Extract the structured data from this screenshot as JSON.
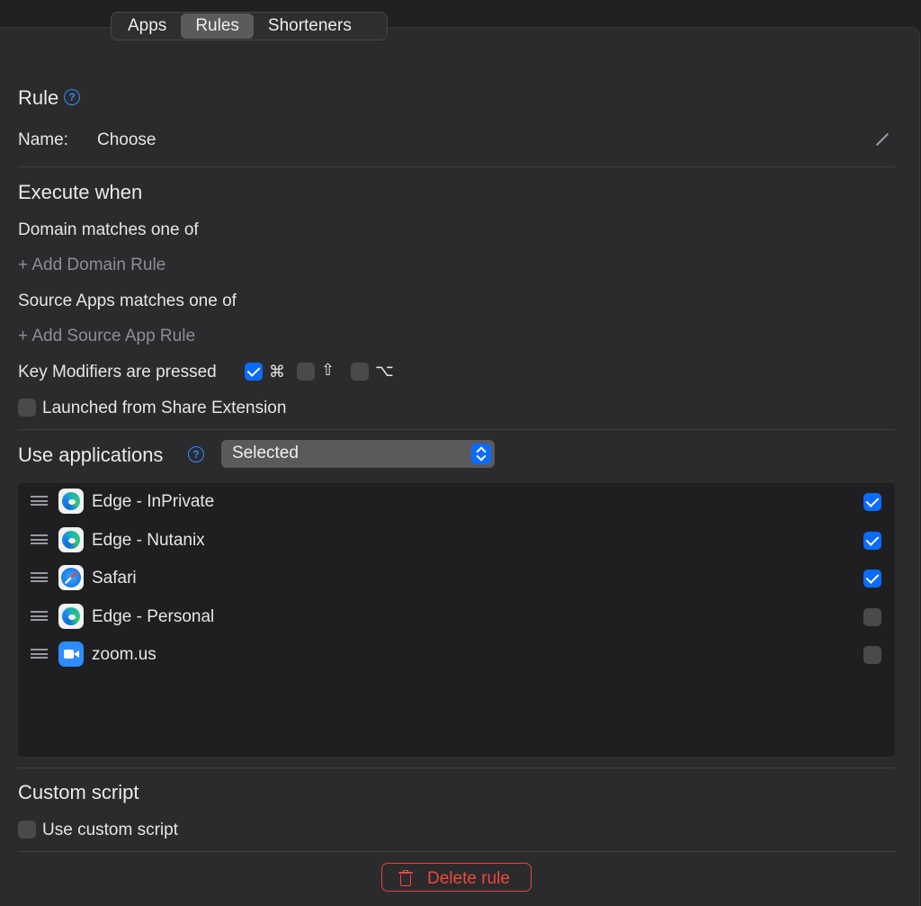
{
  "tabs": [
    {
      "label": "Apps",
      "active": false
    },
    {
      "label": "Rules",
      "active": true
    },
    {
      "label": "Shorteners",
      "active": false
    }
  ],
  "rule": {
    "heading": "Rule",
    "help": "?",
    "name_label": "Name:",
    "name_value": "Choose"
  },
  "execute": {
    "heading": "Execute when",
    "domain_label": "Domain matches one of",
    "add_domain": "+ Add Domain Rule",
    "source_label": "Source Apps matches one of",
    "add_source": "+ Add Source App Rule",
    "modifiers_label": "Key Modifiers are pressed",
    "modifiers": [
      {
        "symbol": "⌘",
        "checked": true
      },
      {
        "symbol": "⇧",
        "checked": false
      },
      {
        "symbol": "⌥",
        "checked": false
      }
    ],
    "share_label": "Launched from Share Extension",
    "share_checked": false
  },
  "use_apps": {
    "heading": "Use applications",
    "help": "?",
    "selected": "Selected",
    "apps": [
      {
        "name": "Edge - InPrivate",
        "icon": "edge-icon",
        "checked": true
      },
      {
        "name": "Edge - Nutanix",
        "icon": "edge-icon",
        "checked": true
      },
      {
        "name": "Safari",
        "icon": "safari-icon",
        "checked": true
      },
      {
        "name": "Edge - Personal",
        "icon": "edge-icon",
        "checked": false
      },
      {
        "name": "zoom.us",
        "icon": "zoom-icon",
        "checked": false
      }
    ]
  },
  "custom": {
    "heading": "Custom script",
    "use_label": "Use custom script",
    "checked": false
  },
  "delete_label": "Delete rule",
  "colors": {
    "accent": "#0a6cff",
    "danger": "#f0483d",
    "panel": "#2b2b2d"
  }
}
